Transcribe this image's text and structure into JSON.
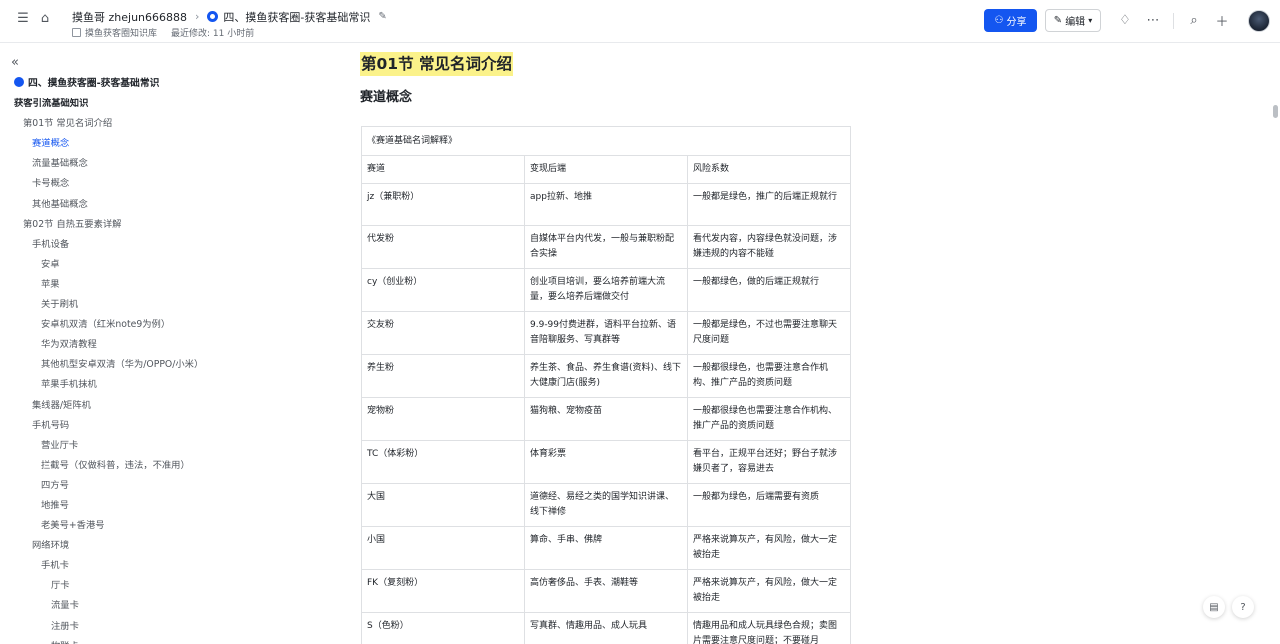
{
  "header": {
    "breadcrumb_owner": "摸鱼哥 zhejun666888",
    "breadcrumb_doc": "四、摸鱼获客圈-获客基础常识",
    "library": "摸鱼获客圈知识库",
    "last_modified": "最近修改: 11 小时前",
    "share_label": "分享",
    "edit_label": "编辑"
  },
  "sidebar": {
    "root": "四、摸鱼获客圈-获客基础常识",
    "items": [
      {
        "label": "获客引流基础知识",
        "level": 0,
        "bold": true
      },
      {
        "label": "第01节 常见名词介绍",
        "level": 1
      },
      {
        "label": "赛道概念",
        "level": 2,
        "active": true
      },
      {
        "label": "流量基础概念",
        "level": 2
      },
      {
        "label": "卡号概念",
        "level": 2
      },
      {
        "label": "其他基础概念",
        "level": 2
      },
      {
        "label": "第02节 自热五要素详解",
        "level": 1
      },
      {
        "label": "手机设备",
        "level": 2
      },
      {
        "label": "安卓",
        "level": 3
      },
      {
        "label": "苹果",
        "level": 3
      },
      {
        "label": "关于刷机",
        "level": 3
      },
      {
        "label": "安卓机双清（红米note9为例）",
        "level": 3
      },
      {
        "label": "华为双清教程",
        "level": 3
      },
      {
        "label": "其他机型安卓双清（华为/OPPO/小米）",
        "level": 3
      },
      {
        "label": "苹果手机抹机",
        "level": 3
      },
      {
        "label": "集线器/矩阵机",
        "level": 2
      },
      {
        "label": "手机号码",
        "level": 2
      },
      {
        "label": "营业厅卡",
        "level": 3
      },
      {
        "label": "拦截号（仅做科普，违法，不准用）",
        "level": 3
      },
      {
        "label": "四方号",
        "level": 3
      },
      {
        "label": "地推号",
        "level": 3
      },
      {
        "label": "老美号+香港号",
        "level": 3
      },
      {
        "label": "网络环境",
        "level": 2
      },
      {
        "label": "手机卡",
        "level": 3
      },
      {
        "label": "厅卡",
        "level": 4
      },
      {
        "label": "流量卡",
        "level": 4
      },
      {
        "label": "注册卡",
        "level": 4
      },
      {
        "label": "物联卡",
        "level": 4
      }
    ]
  },
  "doc": {
    "title": "第01节 常见名词介绍",
    "subtitle": "赛道概念",
    "table": {
      "caption": "《赛道基础名词解释》",
      "headers": [
        "赛道",
        "变现后端",
        "风险系数"
      ],
      "rows": [
        [
          "jz（兼职粉）",
          "app拉新、地推",
          "一般都是绿色，推广的后端正规就行"
        ],
        [
          "代发粉",
          "自媒体平台内代发，一般与兼职粉配合实操",
          "看代发内容，内容绿色就没问题，涉嫌违规的内容不能碰"
        ],
        [
          "cy（创业粉）",
          "创业项目培训，要么培养前端大流量，要么培养后端做交付",
          "一般都绿色，做的后端正规就行"
        ],
        [
          "交友粉",
          "9.9-99付费进群，语料平台拉新、语音陪聊服务、写真群等",
          "一般都是绿色，不过也需要注意聊天尺度问题"
        ],
        [
          "养生粉",
          "养生茶、食品、养生食谱(资料)、线下大健康门店(服务)",
          "一般都很绿色，也需要注意合作机构、推广产品的资质问题"
        ],
        [
          "宠物粉",
          "猫狗粮、宠物疫苗",
          "一般都很绿色也需要注意合作机构、推广产品的资质问题"
        ],
        [
          "TC（体彩粉）",
          "体育彩票",
          "看平台，正规平台还好；野台子就涉嫌贝者了，容易进去"
        ],
        [
          "大国",
          "道德经、易经之类的国学知识讲课、线下禅修",
          "一般都为绿色，后端需要有资质"
        ],
        [
          "小国",
          "算命、手串、佛牌",
          "严格来说算灰产，有风险，做大一定被抬走"
        ],
        [
          "FK（复刻粉）",
          "高仿奢侈品、手表、潮鞋等",
          "严格来说算灰产，有风险，做大一定被抬走"
        ],
        [
          "S（色粉）",
          "写真群、情趣用品、成人玩具",
          "情趣用品和成人玩具绿色合规；卖图片需要注意尺度问题；不要碰月"
        ]
      ]
    }
  }
}
